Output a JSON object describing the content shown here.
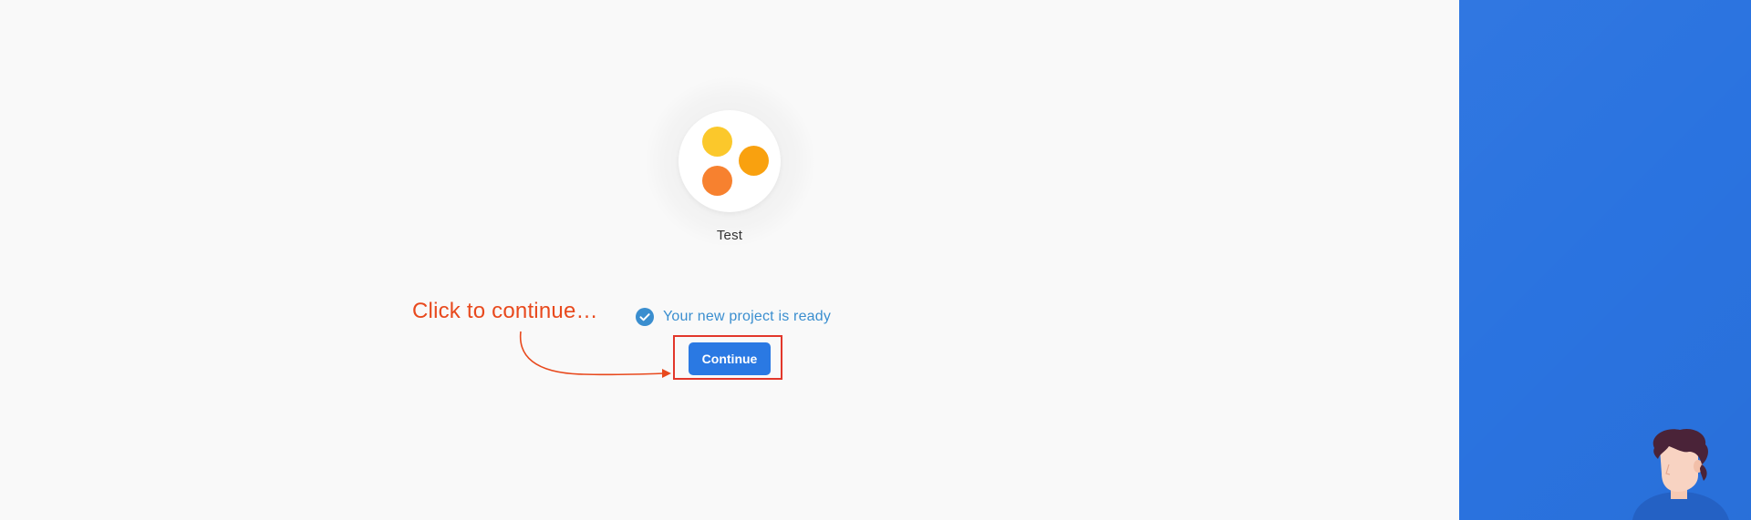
{
  "project": {
    "name": "Test",
    "logo_colors": [
      "#fbc82b",
      "#f9a10f",
      "#f7812f"
    ]
  },
  "status": {
    "text": "Your new project is ready",
    "icon": "check-circle-icon",
    "color": "#3a8ecf"
  },
  "actions": {
    "continue_label": "Continue"
  },
  "annotation": {
    "text": "Click to continue…",
    "color": "#e8491d"
  },
  "side_panel": {
    "color": "#2a73e0",
    "illustration": "person-illustration"
  }
}
